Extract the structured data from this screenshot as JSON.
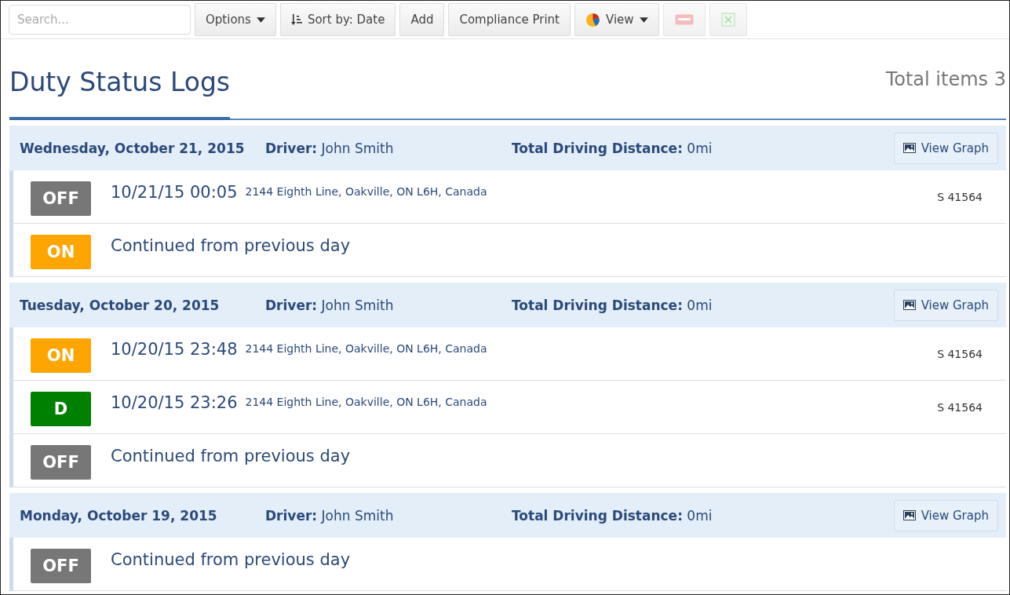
{
  "toolbar": {
    "search": {
      "placeholder": "Search..."
    },
    "buttons": [
      {
        "kind": "dropdown",
        "label": "Options"
      },
      {
        "kind": "sort",
        "label": "Sort by: Date"
      },
      {
        "kind": "plain",
        "label": "Add"
      },
      {
        "kind": "plain",
        "label": "Compliance Print"
      },
      {
        "kind": "view",
        "label": "View"
      },
      {
        "kind": "pdf"
      },
      {
        "kind": "excel"
      }
    ]
  },
  "title": "Duty Status Logs",
  "total": "Total items 3",
  "days": [
    {
      "date": "Wednesday, October 21, 2015",
      "driver_label": "Driver:",
      "driver": "John Smith",
      "distance_label": "Total Driving Distance:",
      "distance": "0mi",
      "graph_button": "View Graph",
      "entries": [
        {
          "kind": "event",
          "status": "OFF",
          "color": "#777777",
          "time": "10/21/15 00:05",
          "address": "2144 Eighth Line, Oakville, ON L6H, Canada",
          "ref": "S 41564"
        },
        {
          "kind": "continued",
          "status": "ON",
          "color": "#ffa500",
          "text": "Continued from previous day"
        }
      ]
    },
    {
      "date": "Tuesday, October 20, 2015",
      "driver_label": "Driver:",
      "driver": "John Smith",
      "distance_label": "Total Driving Distance:",
      "distance": "0mi",
      "graph_button": "View Graph",
      "entries": [
        {
          "kind": "event",
          "status": "ON",
          "color": "#ffa500",
          "time": "10/20/15 23:48",
          "address": "2144 Eighth Line, Oakville, ON L6H, Canada",
          "ref": "S 41564"
        },
        {
          "kind": "event",
          "status": "D",
          "color": "#008000",
          "time": "10/20/15 23:26",
          "address": "2144 Eighth Line, Oakville, ON L6H, Canada",
          "ref": "S 41564"
        },
        {
          "kind": "continued",
          "status": "OFF",
          "color": "#777777",
          "text": "Continued from previous day"
        }
      ]
    },
    {
      "date": "Monday, October 19, 2015",
      "driver_label": "Driver:",
      "driver": "John Smith",
      "distance_label": "Total Driving Distance:",
      "distance": "0mi",
      "graph_button": "View Graph",
      "entries": [
        {
          "kind": "continued",
          "status": "OFF",
          "color": "#777777",
          "text": "Continued from previous day"
        }
      ]
    }
  ]
}
